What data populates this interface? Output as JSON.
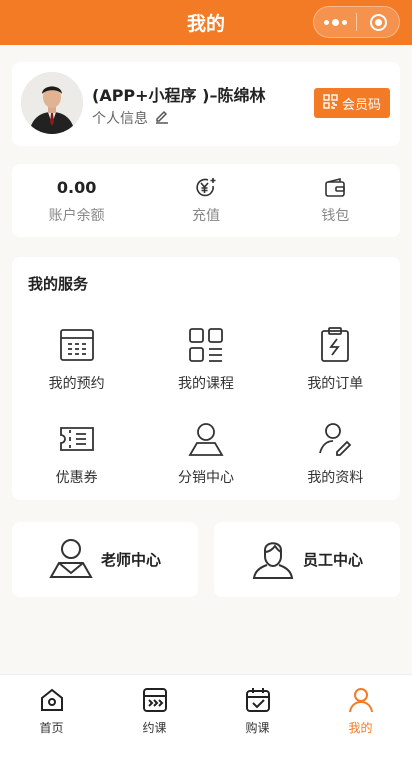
{
  "navbar": {
    "title": "我的"
  },
  "profile": {
    "name": "(APP+小程序 )–陈绵林",
    "info_label": "个人信息",
    "member_code_label": "会员码"
  },
  "stats": [
    {
      "value": "0.00",
      "label": "账户余额"
    },
    {
      "label": "充值",
      "icon": "yuan-plus-icon"
    },
    {
      "label": "钱包",
      "icon": "wallet-icon"
    }
  ],
  "services": {
    "title": "我的服务",
    "items": [
      {
        "label": "我的预约",
        "icon": "calendar-grid-icon"
      },
      {
        "label": "我的课程",
        "icon": "course-grid-icon"
      },
      {
        "label": "我的订单",
        "icon": "clipboard-icon"
      },
      {
        "label": "优惠券",
        "icon": "coupon-icon"
      },
      {
        "label": "分销中心",
        "icon": "person-icon"
      },
      {
        "label": "我的资料",
        "icon": "person-edit-icon"
      }
    ]
  },
  "teacher_center": {
    "label": "老师中心"
  },
  "staff_center": {
    "label": "员工中心"
  },
  "tabbar": {
    "items": [
      {
        "label": "首页",
        "icon": "home-icon"
      },
      {
        "label": "约课",
        "icon": "book-class-icon"
      },
      {
        "label": "购课",
        "icon": "buy-class-icon"
      },
      {
        "label": "我的",
        "icon": "user-icon",
        "active": true
      }
    ]
  },
  "colors": {
    "accent": "#f37b26",
    "background": "#faf8f4"
  }
}
